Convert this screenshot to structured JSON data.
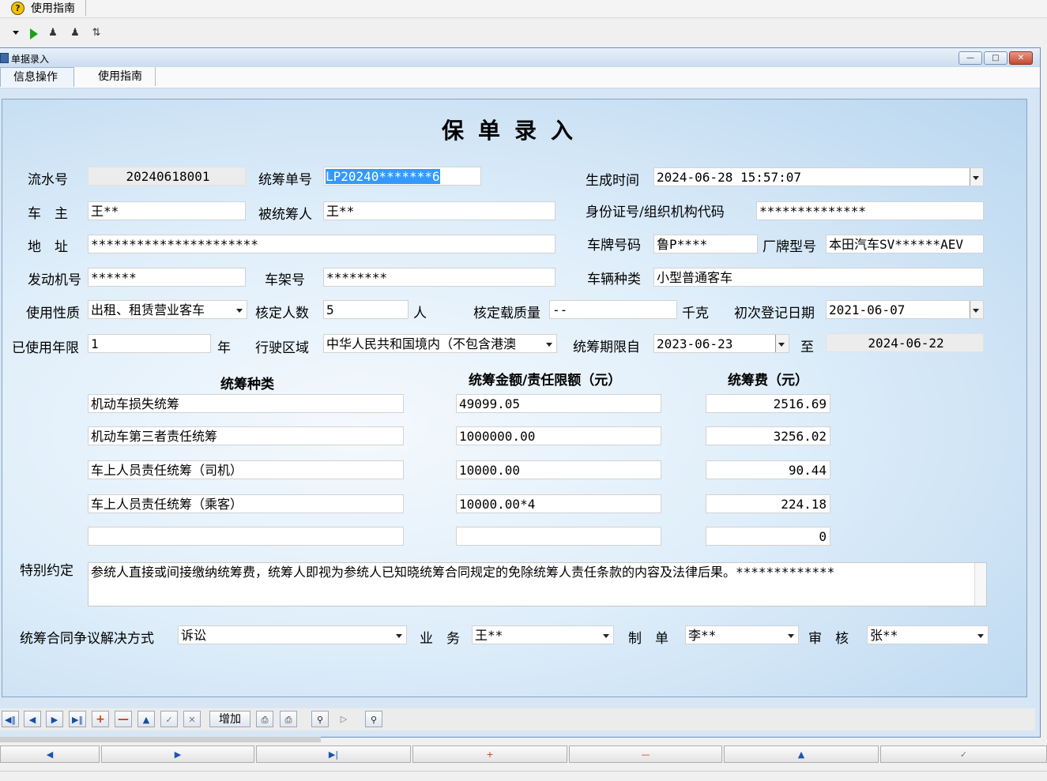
{
  "app": {
    "help_menu": "使用指南",
    "window_title": "单据录入",
    "tabs": [
      "信息操作",
      "使用指南"
    ]
  },
  "form": {
    "heading": "保单录入",
    "labels": {
      "serial": "流水号",
      "policy_no": "统筹单号",
      "gen_time": "生成时间",
      "owner": "车　主",
      "insured": "被统筹人",
      "id_no": "身份证号/组织机构代码",
      "address": "地　址",
      "plate": "车牌号码",
      "model": "厂牌型号",
      "engine": "发动机号",
      "vin": "车架号",
      "vehicle_type": "车辆种类",
      "usage": "使用性质",
      "seats": "核定人数",
      "seats_unit": "人",
      "load": "核定载质量",
      "load_unit": "千克",
      "reg_date": "初次登记日期",
      "years_used": "已使用年限",
      "years_unit": "年",
      "region": "行驶区域",
      "period_from": "统筹期限自",
      "period_to": "至",
      "col_kind": "统筹种类",
      "col_amount": "统筹金额/责任限额（元）",
      "col_fee": "统筹费（元）",
      "special": "特别约定",
      "dispute": "统筹合同争议解决方式",
      "business": "业　务",
      "maker": "制　单",
      "auditor": "审　核"
    },
    "values": {
      "serial": "20240618001",
      "policy_no": "LP20240*******6",
      "gen_time": "2024-06-28 15:57:07",
      "owner": "王**",
      "insured": "王**",
      "id_no": "**************",
      "address": "**********************",
      "plate": "鲁P****",
      "model": "本田汽车SV******AEV",
      "engine": "******",
      "vin": "********",
      "vehicle_type": "小型普通客车",
      "usage": "出租、租赁营业客车",
      "seats": "5",
      "load": "--",
      "reg_date": "2021-06-07",
      "years_used": "1",
      "region": "中华人民共和国境内（不包含港澳",
      "period_from": "2023-06-23",
      "period_to": "2024-06-22",
      "special_text": "参统人直接或间接缴纳统筹费，统筹人即视为参统人已知晓统筹合同规定的免除统筹人责任条款的内容及法律后果。*************",
      "dispute": "诉讼",
      "business": "王**",
      "maker": "李**",
      "auditor": "张**"
    },
    "coverage_rows": [
      {
        "kind": "机动车损失统筹",
        "amount": "49099.05",
        "fee": "2516.69"
      },
      {
        "kind": "机动车第三者责任统筹",
        "amount": "1000000.00",
        "fee": "3256.02"
      },
      {
        "kind": "车上人员责任统筹（司机）",
        "amount": "10000.00",
        "fee": "90.44"
      },
      {
        "kind": "车上人员责任统筹（乘客）",
        "amount": "10000.00*4",
        "fee": "224.18"
      },
      {
        "kind": "",
        "amount": "",
        "fee": "0"
      }
    ]
  },
  "navigator": {
    "add_label": "增加"
  }
}
